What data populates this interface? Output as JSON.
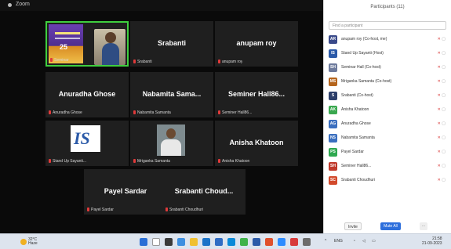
{
  "window": {
    "label": "Zoom"
  },
  "gallery": {
    "tiles": [
      {
        "name": "",
        "tag": "Seminar"
      },
      {
        "name": "Srabanti",
        "tag": "Srabanti"
      },
      {
        "name": "anupam roy",
        "tag": "anupam roy"
      },
      {
        "name": "Anuradha Ghose",
        "tag": "Anuradha Ghose"
      },
      {
        "name": "Nabamita Sama...",
        "tag": "Nabamita Samanta"
      },
      {
        "name": "Seminer Hall86...",
        "tag": "Seminer Hall86..."
      },
      {
        "name": "",
        "tag": "Stand Up Sayanti..."
      },
      {
        "name": "",
        "tag": "Mriganka Samanta"
      },
      {
        "name": "Anisha Khatoon",
        "tag": "Anisha Khatoon"
      },
      {
        "name": "Payel Sardar",
        "tag": "Payel Sardar"
      },
      {
        "name": "Srabanti Choud...",
        "tag": "Srabanti Choudhuri"
      }
    ],
    "banner_number": "25"
  },
  "panel": {
    "title": "Participants (11)",
    "search_placeholder": "Find a participant",
    "participants": [
      {
        "initials": "AR",
        "name": "anupam roy (Co-host, me)",
        "color": "#3a4a8a",
        "icons": "mic video"
      },
      {
        "initials": "IS",
        "name": "Stand Up Sayanti (Host)",
        "color": "#2b5aa8",
        "icons": "mic video"
      },
      {
        "initials": "SH",
        "name": "Seminar Hall (Co-host)",
        "color": "#6d7a9c",
        "icons": "mic video"
      },
      {
        "initials": "MS",
        "name": "Mriganka Samanta (Co-host)",
        "color": "#b5651d",
        "icons": "mic video"
      },
      {
        "initials": "S",
        "name": "Srabanti (Co-host)",
        "color": "#2d3f6b",
        "icons": "mic video"
      },
      {
        "initials": "AK",
        "name": "Anisha Khatoon",
        "color": "#3aa84f",
        "icons": "mic video"
      },
      {
        "initials": "AG",
        "name": "Anuradha Ghose",
        "color": "#3b6fbf",
        "icons": "mic video"
      },
      {
        "initials": "NS",
        "name": "Nabamita Samanta",
        "color": "#3b6fbf",
        "icons": "mic video"
      },
      {
        "initials": "PS",
        "name": "Payel Sardar",
        "color": "#2ea84f",
        "icons": "mic video"
      },
      {
        "initials": "SH",
        "name": "Seminer Hall86...",
        "color": "#c0392b",
        "icons": "mic video"
      },
      {
        "initials": "SC",
        "name": "Srabanti Choudhuri",
        "color": "#d24a2c",
        "icons": "mic video"
      }
    ],
    "footer": {
      "invite_label": "Invite",
      "mute_all_label": "Mute All"
    }
  },
  "taskbar": {
    "weather_temp": "32°C",
    "weather_desc": "Haze",
    "clock_time": "21:58",
    "clock_date": "21-09-2023",
    "tray_lang": "ENG"
  }
}
